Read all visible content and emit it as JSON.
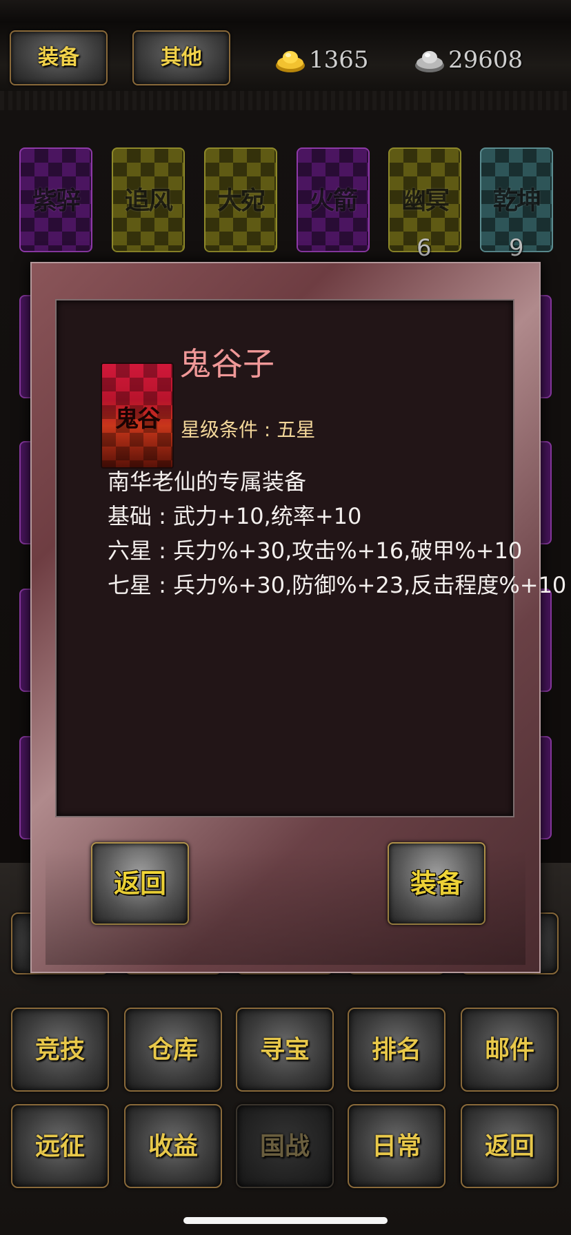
{
  "topbar": {
    "tab_equip": "装备",
    "tab_other": "其他",
    "gold_icon": "gold-ingot-icon",
    "gold_value": "1365",
    "silver_icon": "silver-ingot-icon",
    "silver_value": "29608"
  },
  "mounts": [
    {
      "name": "紫骍",
      "color": "purple",
      "count": ""
    },
    {
      "name": "追风",
      "color": "olive",
      "count": ""
    },
    {
      "name": "大宛",
      "color": "olive",
      "count": ""
    },
    {
      "name": "火箭",
      "color": "purple",
      "count": ""
    },
    {
      "name": "幽冥",
      "color": "olive",
      "count": "6"
    },
    {
      "name": "乾坤",
      "color": "teal",
      "count": "9"
    }
  ],
  "menu": {
    "row1": [
      "竞技",
      "仓库",
      "寻宝",
      "排名",
      "邮件"
    ],
    "row2": [
      "远征",
      "收益",
      "国战",
      "日常",
      "返回"
    ]
  },
  "modal": {
    "icon_label": "鬼谷",
    "item_name": "鬼谷子",
    "star_condition": "星级条件 : 五星",
    "desc_lines": [
      "南华老仙的专属装备",
      "基础 : 武力+10,统率+10",
      "六星 : 兵力%+30,攻击%+16,破甲%+10",
      "七星 : 兵力%+30,防御%+23,反击程度%+10"
    ],
    "back_label": "返回",
    "equip_label": "装备"
  }
}
